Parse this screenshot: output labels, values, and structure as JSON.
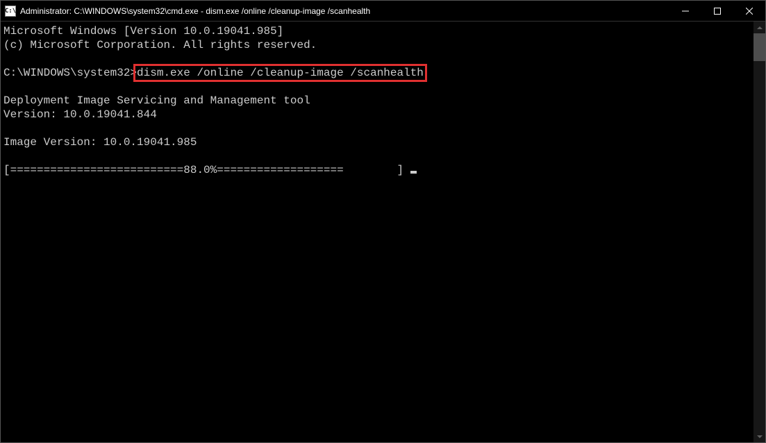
{
  "window": {
    "title": "Administrator: C:\\WINDOWS\\system32\\cmd.exe - dism.exe  /online /cleanup-image /scanhealth"
  },
  "terminal": {
    "line1": "Microsoft Windows [Version 10.0.19041.985]",
    "line2": "(c) Microsoft Corporation. All rights reserved.",
    "blank1": "",
    "prompt_prefix": "C:\\WINDOWS\\system32>",
    "command": "dism.exe /online /cleanup-image /scanhealth",
    "blank2": "",
    "tool_line1": "Deployment Image Servicing and Management tool",
    "tool_line2": "Version: 10.0.19041.844",
    "blank3": "",
    "image_version": "Image Version: 10.0.19041.985",
    "blank4": "",
    "progress": "[==========================88.0%===================        ] "
  }
}
